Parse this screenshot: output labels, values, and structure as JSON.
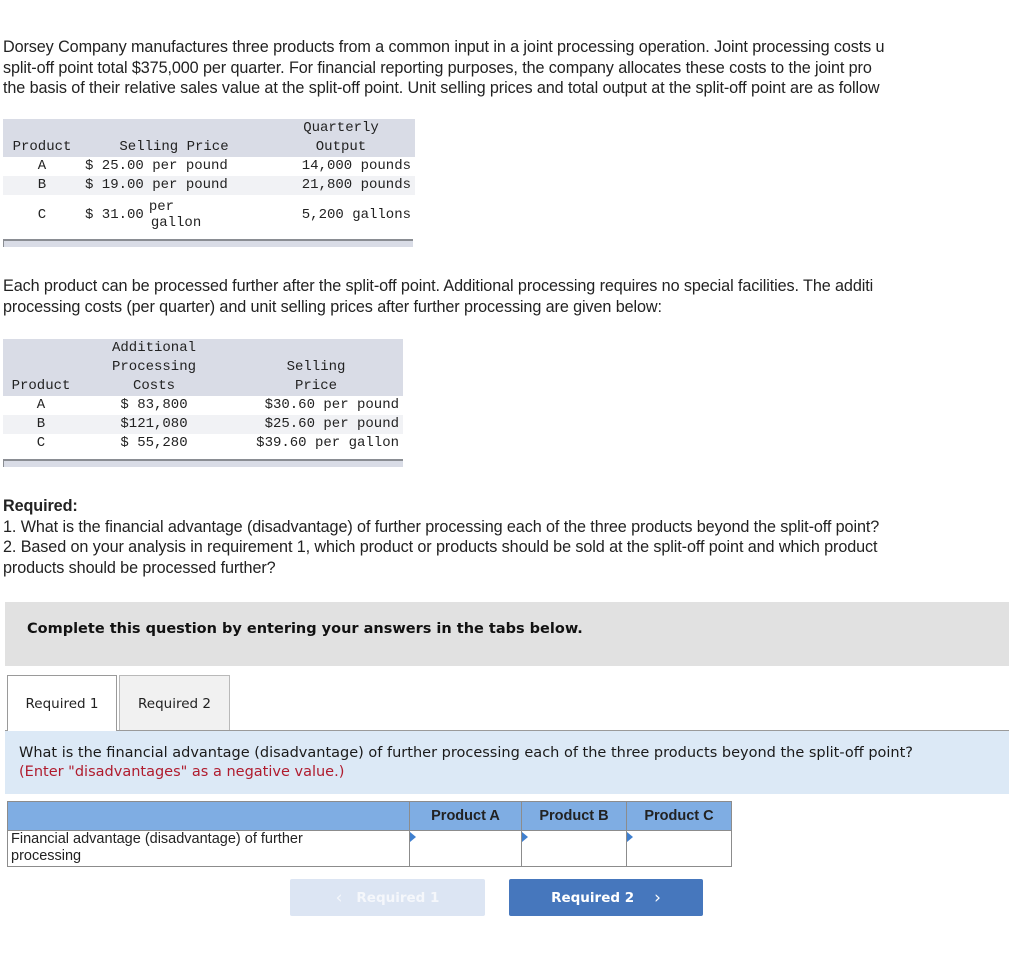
{
  "intro": {
    "lines": [
      "Dorsey Company manufactures three products from a common input in a joint processing operation. Joint processing costs u",
      "split-off point total $375,000 per quarter. For financial reporting purposes, the company allocates these costs to the joint pro",
      "the basis of their relative sales value at the split-off point. Unit selling prices and total output at the split-off point are as follow"
    ]
  },
  "splitoff_table": {
    "headers": {
      "product": "Product",
      "selling_price": "Selling Price",
      "output_line1": "Quarterly",
      "output_line2": "Output"
    },
    "rows": [
      {
        "product": "A",
        "price": "$ 25.00",
        "unit": "per pound",
        "output": "14,000 pounds"
      },
      {
        "product": "B",
        "price": "$ 19.00",
        "unit": "per pound",
        "output": "21,800 pounds"
      },
      {
        "product": "C",
        "price": "$ 31.00",
        "unit_line1": "per",
        "unit_line2": "gallon",
        "output": "5,200 gallons"
      }
    ]
  },
  "para2": {
    "lines": [
      "Each product can be processed further after the split-off point. Additional processing requires no special facilities. The additi",
      "processing costs (per quarter) and unit selling prices after further processing are given below:"
    ]
  },
  "further_table": {
    "headers": {
      "product": "Product",
      "cost_line1": "Additional",
      "cost_line2": "Processing",
      "cost_line3": "Costs",
      "sell_line1": "Selling",
      "sell_line2": "Price"
    },
    "rows": [
      {
        "product": "A",
        "cost": "$ 83,800",
        "price": "$30.60 per pound"
      },
      {
        "product": "B",
        "cost": "$121,080",
        "price": "$25.60 per pound"
      },
      {
        "product": "C",
        "cost": "$ 55,280",
        "price": "$39.60 per gallon"
      }
    ]
  },
  "required": {
    "heading": "Required:",
    "lines": [
      "1. What is the financial advantage (disadvantage) of further processing each of the three products beyond the split-off point?",
      "2. Based on your analysis in requirement 1, which product or products should be sold at the split-off point and which product",
      "products should be processed further?"
    ]
  },
  "instruction_banner": "Complete this question by entering your answers in the tabs below.",
  "tabs": [
    {
      "label": "Required 1",
      "active": true
    },
    {
      "label": "Required 2",
      "active": false
    }
  ],
  "question": {
    "text": "What is the financial advantage (disadvantage) of further processing each of the three products beyond the split-off point?",
    "note": "(Enter \"disadvantages\" as a negative value.)"
  },
  "answer_table": {
    "columns": [
      "Product A",
      "Product B",
      "Product C"
    ],
    "row_label_line1": "Financial advantage (disadvantage) of further",
    "row_label_line2": "processing",
    "values": [
      "",
      "",
      ""
    ]
  },
  "nav": {
    "prev_label": "Required 1",
    "next_label": "Required 2",
    "prev_chevron": "‹",
    "next_chevron": "›"
  },
  "colors": {
    "table_header": "#d9dce6",
    "banner": "#e1e1e1",
    "question_panel": "#dce9f6",
    "answer_header": "#7fade3",
    "note_red": "#b01c2e",
    "next_button": "#4677bd",
    "prev_button_disabled": "#dce5f3"
  }
}
